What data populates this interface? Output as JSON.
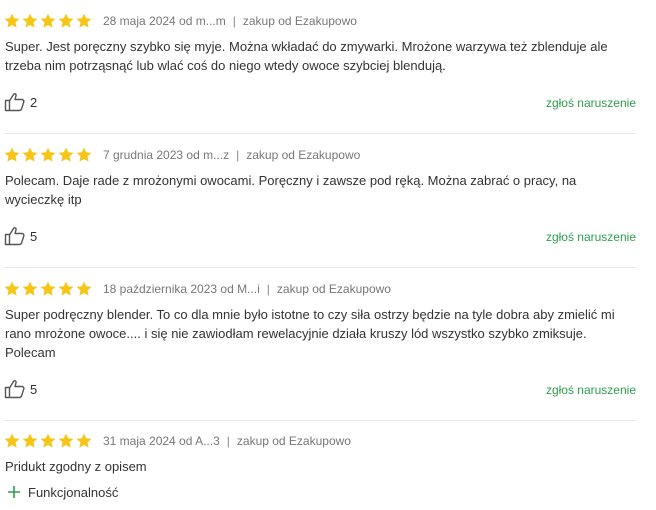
{
  "colors": {
    "star": "#f5c518",
    "accent_green": "#2e9e4f",
    "meta_gray": "#777777",
    "divider": "#e6e6e6"
  },
  "icons": {
    "star": "star-icon",
    "like": "thumbs-up-icon",
    "pro": "plus-icon"
  },
  "reviews": [
    {
      "rating": 5,
      "date_author": "28 maja 2024 od m...m",
      "source": "zakup od Ezakupowo",
      "text": "Super. Jest poręczny szybko się myje. Można wkładać do zmywarki. Mrożone warzywa też zblenduje ale trzeba nim potrząsnąć lub wlać coś do niego wtedy owoce szybciej blendują.",
      "likes": "2",
      "report_label": "zgłoś naruszenie"
    },
    {
      "rating": 5,
      "date_author": "7 grudnia 2023 od m...z",
      "source": "zakup od Ezakupowo",
      "text": "Polecam. Daje rade z mrożonymi owocami. Poręczny i zawsze pod ręką. Można zabrać o pracy, na wycieczkę itp",
      "likes": "5",
      "report_label": "zgłoś naruszenie"
    },
    {
      "rating": 5,
      "date_author": "18 października 2023 od M...i",
      "source": "zakup od Ezakupowo",
      "text": "Super podręczny blender. To co dla mnie było istotne to czy siła ostrzy będzie na tyle dobra aby zmielić mi rano mrożone owoce.... i się nie zawiodłam rewelacyjnie działa kruszy lód wszystko szybko zmiksuje. Polecam",
      "likes": "5",
      "report_label": "zgłoś naruszenie"
    },
    {
      "rating": 5,
      "date_author": "31 maja 2024 od A...3",
      "source": "zakup od Ezakupowo",
      "text": "Pridukt zgodny z opisem",
      "pros": [
        "Funkcjonalność"
      ]
    }
  ]
}
